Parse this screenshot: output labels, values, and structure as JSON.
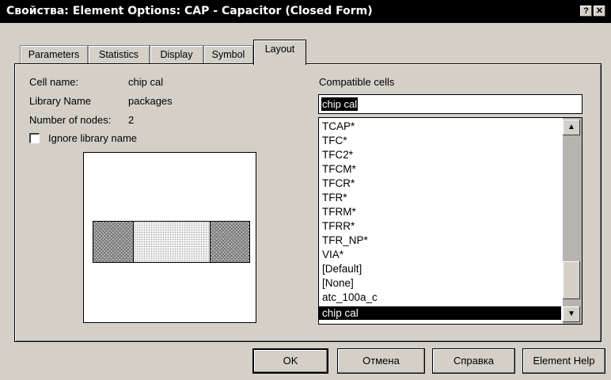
{
  "window": {
    "title": "Свойства: Element Options: CAP - Capacitor (Closed Form)",
    "help_button": "?",
    "close_button": "✕"
  },
  "tabs": [
    {
      "label": "Parameters"
    },
    {
      "label": "Statistics"
    },
    {
      "label": "Display"
    },
    {
      "label": "Symbol"
    },
    {
      "label": "Layout"
    }
  ],
  "active_tab": "Layout",
  "info": {
    "cell_name_label": "Cell name:",
    "cell_name_value": "chip cal",
    "library_name_label": "Library Name",
    "library_name_value": "packages",
    "nodes_label": "Number of nodes:",
    "nodes_value": "2",
    "ignore_library_label": "Ignore library name",
    "ignore_library_checked": false
  },
  "compatible": {
    "label": "Compatible cells",
    "input_value": "chip cal",
    "items": [
      "TCAP*",
      "TFC*",
      "TFC2*",
      "TFCM*",
      "TFCR*",
      "TFR*",
      "TFRM*",
      "TFRR*",
      "TFR_NP*",
      "VIA*",
      "[Default]",
      "[None]",
      "atc_100a_c",
      "chip cal"
    ],
    "selected_item": "chip cal"
  },
  "buttons": {
    "ok": "OK",
    "cancel": "Отмена",
    "help": "Справка",
    "element_help": "Element Help"
  },
  "colors": {
    "title_bg": "#000000",
    "dialog_bg": "#d4d0c8",
    "selection_bg": "#000000"
  }
}
